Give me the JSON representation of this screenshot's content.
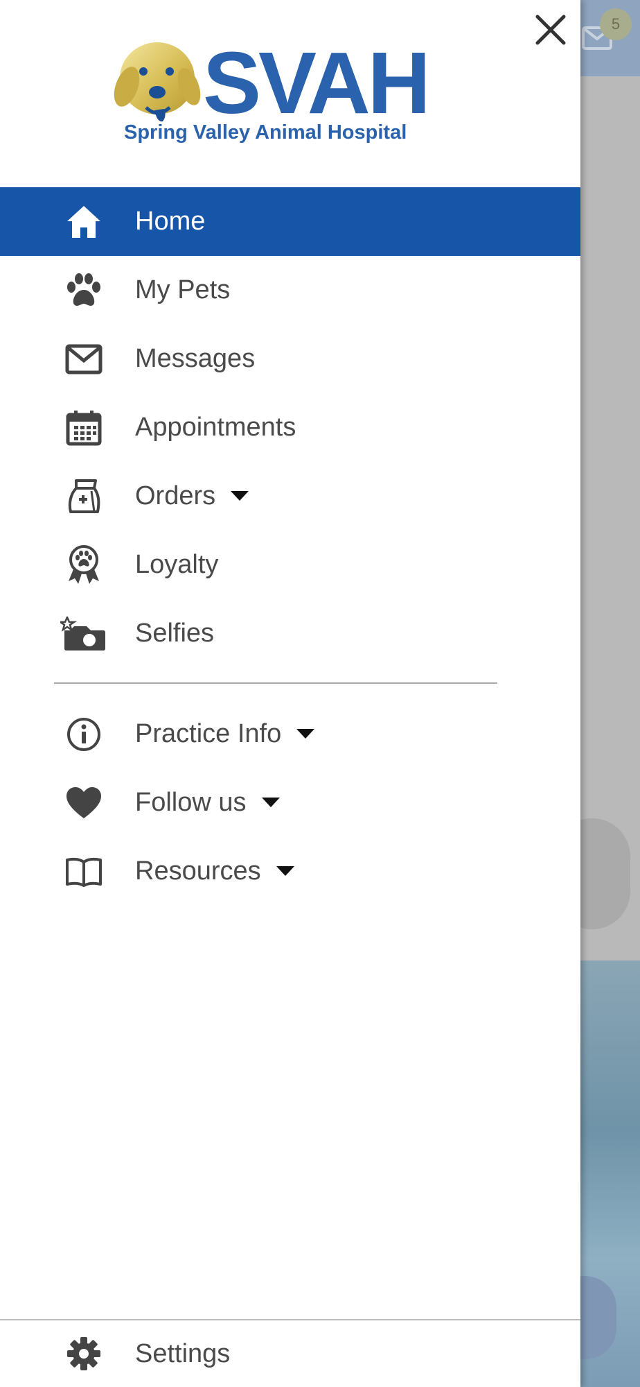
{
  "background": {
    "mail_badge_count": "5"
  },
  "brand": {
    "logo_text": "SVAH",
    "logo_subtitle": "Spring Valley Animal Hospital",
    "accent_color": "#1655a8",
    "gold_color": "#d9c25a"
  },
  "drawer": {
    "close_icon": "close-icon",
    "menu": [
      {
        "label": "Home",
        "icon": "home-icon",
        "active": true,
        "has_dropdown": false
      },
      {
        "label": "My Pets",
        "icon": "paw-icon",
        "active": false,
        "has_dropdown": false
      },
      {
        "label": "Messages",
        "icon": "envelope-icon",
        "active": false,
        "has_dropdown": false
      },
      {
        "label": "Appointments",
        "icon": "calendar-icon",
        "active": false,
        "has_dropdown": false
      },
      {
        "label": "Orders",
        "icon": "medicine-bag-icon",
        "active": false,
        "has_dropdown": true
      },
      {
        "label": "Loyalty",
        "icon": "award-ribbon-icon",
        "active": false,
        "has_dropdown": false
      },
      {
        "label": "Selfies",
        "icon": "camera-star-icon",
        "active": false,
        "has_dropdown": false
      }
    ],
    "secondary_menu": [
      {
        "label": "Practice Info",
        "icon": "info-icon",
        "has_dropdown": true
      },
      {
        "label": "Follow us",
        "icon": "heart-icon",
        "has_dropdown": true
      },
      {
        "label": "Resources",
        "icon": "book-icon",
        "has_dropdown": true
      }
    ],
    "settings": {
      "label": "Settings",
      "icon": "gear-icon"
    }
  }
}
